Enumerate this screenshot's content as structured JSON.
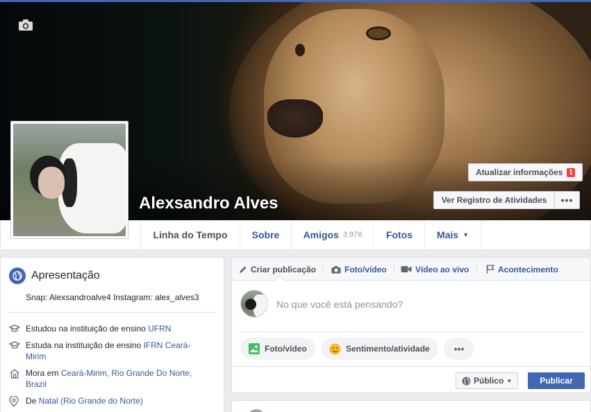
{
  "profile": {
    "name": "Alexsandro Alves",
    "update_info_label": "Atualizar informações",
    "update_info_badge": "1",
    "activity_log_label": "Ver Registro de Atividades",
    "more_label": "•••"
  },
  "nav": {
    "tabs": [
      {
        "label": "Linha do Tempo"
      },
      {
        "label": "Sobre"
      },
      {
        "label": "Amigos",
        "count": "3.976"
      },
      {
        "label": "Fotos"
      },
      {
        "label": "Mais",
        "caret": "▼"
      }
    ]
  },
  "intro": {
    "title": "Apresentação",
    "bio": "Snap: Alexsandroalve4 Instagram: alex_alves3",
    "items": [
      {
        "prefix": "Estudou na instituição de ensino ",
        "link": "UFRN",
        "icon": "graduation-cap-icon"
      },
      {
        "prefix": "Estuda na instituição de ensino ",
        "link": "IFRN Ceará-Mirim",
        "icon": "graduation-cap-icon"
      },
      {
        "prefix": "Mora em ",
        "link": "Ceará-Mirim, Rio Grande Do Norte, Brazil",
        "icon": "home-icon"
      },
      {
        "prefix": "De ",
        "link": "Natal (Rio Grande do Norte)",
        "icon": "location-pin-icon"
      }
    ]
  },
  "composer": {
    "tabs": [
      {
        "label": "Criar publicação",
        "icon": "pencil-icon"
      },
      {
        "label": "Foto/vídeo",
        "icon": "camera-icon"
      },
      {
        "label": "Vídeo ao vivo",
        "icon": "video-camera-icon"
      },
      {
        "label": "Acontecimento",
        "icon": "flag-icon"
      }
    ],
    "placeholder": "No que você está pensando?",
    "pills": [
      {
        "label": "Foto/vídeo",
        "icon": "photo-icon"
      },
      {
        "label": "Sentimento/atividade",
        "icon": "smiley-icon"
      },
      {
        "label": "•••",
        "icon": "more-icon"
      }
    ],
    "audience_label": "Público",
    "publish_label": "Publicar"
  },
  "colors": {
    "brand_blue": "#4267b2",
    "link_blue": "#365899",
    "badge_red": "#fa3e3e",
    "background": "#e9ebee"
  }
}
